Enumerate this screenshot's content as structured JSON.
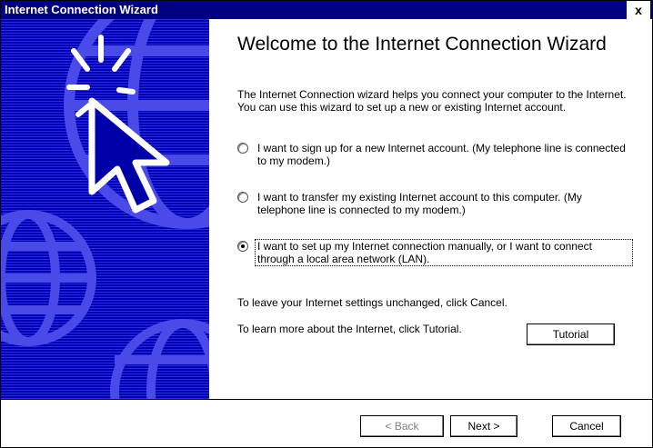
{
  "window": {
    "title": "Internet Connection Wizard",
    "close_glyph": "x"
  },
  "main": {
    "heading": "Welcome to the Internet Connection Wizard",
    "intro": "The Internet Connection wizard helps you connect your computer to the Internet.  You can use this wizard to set up a new or existing Internet account.",
    "options": [
      {
        "label": "I want to sign up for a new Internet account. (My telephone line is connected to my modem.)",
        "selected": false
      },
      {
        "label": "I want to transfer my existing Internet account to this computer. (My telephone line is connected to my modem.)",
        "selected": false
      },
      {
        "label": "I want to set up my Internet connection manually, or I want to connect through a local area network (LAN).",
        "selected": true
      }
    ],
    "cancel_note": "To leave your Internet settings unchanged, click Cancel.",
    "tutorial_note": "To learn more about the Internet, click Tutorial.",
    "tutorial_button": "Tutorial"
  },
  "footer": {
    "back_label": "< Back",
    "next_label": "Next >",
    "cancel_label": "Cancel"
  },
  "colors": {
    "titlebar": "#000080",
    "art_background": "#0000a8"
  }
}
